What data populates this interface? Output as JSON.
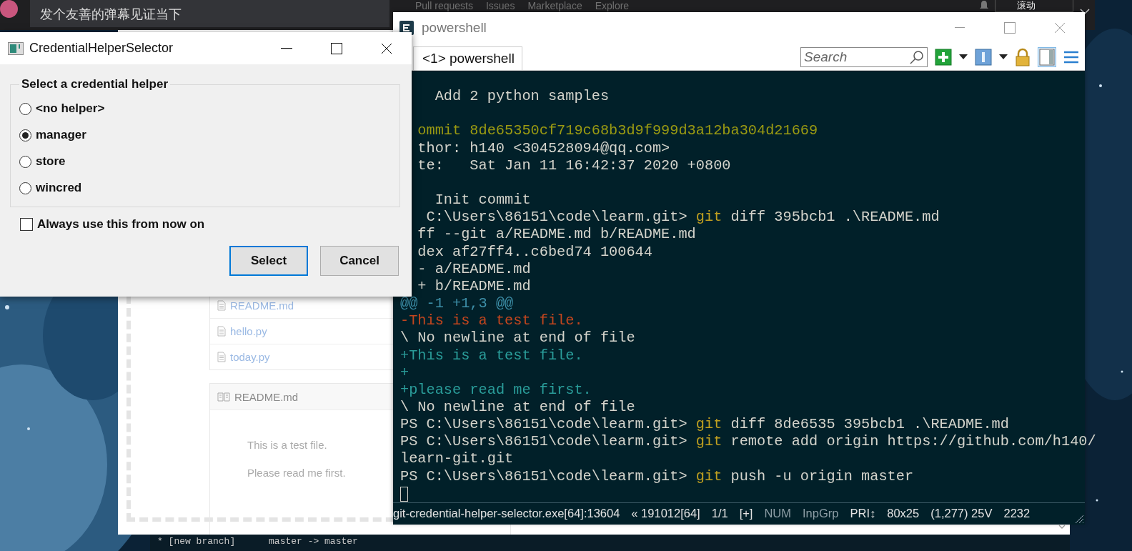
{
  "top_bar": {
    "danmaku_input": {
      "placeholder": "发个友善的弹幕见证当下"
    },
    "nav_links": [
      "Pull requests",
      "Issues",
      "Marketplace",
      "Explore"
    ],
    "scroll_toggle": "滚动"
  },
  "browser_page": {
    "files": [
      {
        "name": "README.md"
      },
      {
        "name": "hello.py"
      },
      {
        "name": "today.py"
      }
    ],
    "readme": {
      "title": "README.md",
      "paragraphs": [
        "This is a test file.",
        "Please read me first."
      ]
    }
  },
  "bottom_console": {
    "lines": [
      "* [new branch]      master -> master"
    ]
  },
  "dialog": {
    "title": "CredentialHelperSelector",
    "group_label": "Select a credential helper",
    "options": [
      {
        "label": "<no helper>",
        "selected": false
      },
      {
        "label": "manager",
        "selected": true
      },
      {
        "label": "store",
        "selected": false
      },
      {
        "label": "wincred",
        "selected": false
      }
    ],
    "remember": {
      "label": "Always use this from now on",
      "checked": false
    },
    "buttons": [
      {
        "label": "Select",
        "default": true
      },
      {
        "label": "Cancel",
        "default": false
      }
    ]
  },
  "console_window": {
    "title": "powershell",
    "tabs": [
      {
        "label": "<1> powershell",
        "selected": true
      }
    ],
    "search": {
      "placeholder": "Search"
    },
    "lines": [
      {
        "kind": "blank"
      },
      {
        "kind": "text",
        "clipped": false,
        "segments": [
          {
            "kind": "plain",
            "text": "    Add 2 python samples"
          }
        ]
      },
      {
        "kind": "blank"
      },
      {
        "kind": "text",
        "clipped": true,
        "segments": [
          {
            "kind": "hash",
            "text": "ommit 8de65350cf719c68b3d9f999d3a12ba304d21669"
          }
        ]
      },
      {
        "kind": "text",
        "clipped": true,
        "segments": [
          {
            "kind": "plain",
            "text": "thor: h140 <304528094@qq.com>"
          }
        ]
      },
      {
        "kind": "text",
        "clipped": true,
        "segments": [
          {
            "kind": "plain",
            "text": "te:   Sat Jan 11 16:42:37 2020 +0800"
          }
        ]
      },
      {
        "kind": "blank"
      },
      {
        "kind": "text",
        "clipped": false,
        "segments": [
          {
            "kind": "plain",
            "text": "    Init commit"
          }
        ]
      },
      {
        "kind": "text",
        "clipped": true,
        "segments": [
          {
            "kind": "plain",
            "text": " C:\\Users\\86151\\code\\learm.git> "
          },
          {
            "kind": "command",
            "text": "git"
          },
          {
            "kind": "plain",
            "text": " diff 395bcb1 .\\README.md"
          }
        ]
      },
      {
        "kind": "text",
        "clipped": true,
        "segments": [
          {
            "kind": "plain",
            "text": "ff --git a/README.md b/README.md"
          }
        ]
      },
      {
        "kind": "text",
        "clipped": true,
        "segments": [
          {
            "kind": "plain",
            "text": "dex af27ff4..c6bed74 100644"
          }
        ]
      },
      {
        "kind": "text",
        "clipped": true,
        "segments": [
          {
            "kind": "plain",
            "text": "- a/README.md"
          }
        ]
      },
      {
        "kind": "text",
        "clipped": true,
        "segments": [
          {
            "kind": "plain",
            "text": "+ b/README.md"
          }
        ]
      },
      {
        "kind": "text",
        "clipped": false,
        "segments": [
          {
            "kind": "hunk",
            "text": "@@ -1 +1,3 @@"
          }
        ]
      },
      {
        "kind": "text",
        "clipped": false,
        "segments": [
          {
            "kind": "removed",
            "text": "-This is a test file."
          }
        ]
      },
      {
        "kind": "text",
        "clipped": false,
        "segments": [
          {
            "kind": "plain",
            "text": "\\ No newline at end of file"
          }
        ]
      },
      {
        "kind": "text",
        "clipped": false,
        "segments": [
          {
            "kind": "added",
            "text": "+This is a test file."
          }
        ]
      },
      {
        "kind": "text",
        "clipped": false,
        "segments": [
          {
            "kind": "added",
            "text": "+"
          }
        ]
      },
      {
        "kind": "text",
        "clipped": false,
        "segments": [
          {
            "kind": "added",
            "text": "+please read me first."
          }
        ]
      },
      {
        "kind": "text",
        "clipped": false,
        "segments": [
          {
            "kind": "plain",
            "text": "\\ No newline at end of file"
          }
        ]
      },
      {
        "kind": "text",
        "clipped": false,
        "segments": [
          {
            "kind": "plain",
            "text": "PS C:\\Users\\86151\\code\\learm.git> "
          },
          {
            "kind": "command",
            "text": "git"
          },
          {
            "kind": "plain",
            "text": " diff 8de6535 395bcb1 .\\README.md"
          }
        ]
      },
      {
        "kind": "text",
        "clipped": false,
        "segments": [
          {
            "kind": "plain",
            "text": "PS C:\\Users\\86151\\code\\learm.git> "
          },
          {
            "kind": "command",
            "text": "git"
          },
          {
            "kind": "plain",
            "text": " remote add origin https://github.com/h140/"
          }
        ]
      },
      {
        "kind": "text",
        "clipped": false,
        "segments": [
          {
            "kind": "plain",
            "text": "learn-git.git"
          }
        ]
      },
      {
        "kind": "text",
        "clipped": false,
        "segments": [
          {
            "kind": "plain",
            "text": "PS C:\\Users\\86151\\code\\learm.git> "
          },
          {
            "kind": "command",
            "text": "git"
          },
          {
            "kind": "plain",
            "text": " push -u origin master"
          }
        ]
      },
      {
        "kind": "cursor"
      }
    ],
    "status_bar": [
      {
        "text": "git-credential-helper-selector.exe[64]:13604",
        "disabled": false
      },
      {
        "text": "« 191012[64]",
        "disabled": false
      },
      {
        "text": "1/1",
        "disabled": false
      },
      {
        "text": "[+]",
        "disabled": false
      },
      {
        "text": "NUM",
        "disabled": true
      },
      {
        "text": "InpGrp",
        "disabled": true
      },
      {
        "text": "PRI↕",
        "disabled": false
      },
      {
        "text": "80x25",
        "disabled": false
      },
      {
        "text": "(1,277) 25V",
        "disabled": false
      },
      {
        "text": "2232",
        "disabled": false
      }
    ]
  }
}
